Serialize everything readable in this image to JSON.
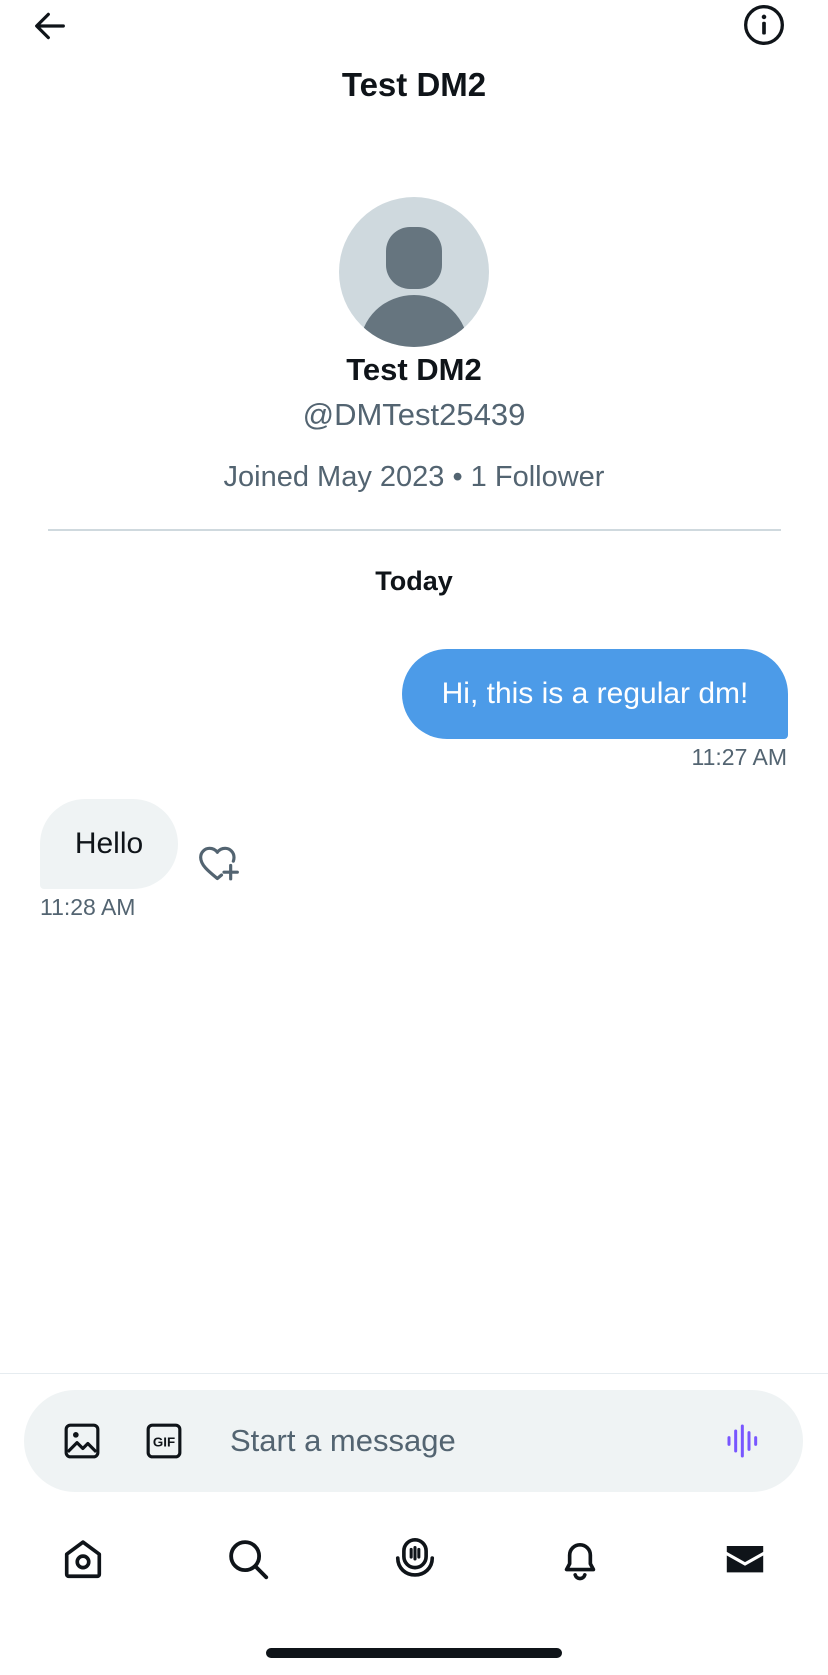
{
  "header": {
    "title": "Test DM2",
    "back_icon": "arrow-left-icon",
    "info_icon": "info-circle-icon"
  },
  "profile": {
    "name": "Test DM2",
    "handle": "@DMTest25439",
    "meta": "Joined May 2023 • 1 Follower",
    "avatar_icon": "default-avatar-icon"
  },
  "conversation": {
    "day_label": "Today",
    "messages": [
      {
        "direction": "outgoing",
        "text": "Hi, this is a regular dm!",
        "time": "11:27 AM"
      },
      {
        "direction": "incoming",
        "text": "Hello",
        "time": "11:28 AM"
      }
    ],
    "reaction_icon": "heart-plus-icon"
  },
  "composer": {
    "placeholder": "Start a message",
    "image_icon": "image-icon",
    "gif_icon": "gif-icon",
    "voice_icon": "voice-waveform-icon"
  },
  "tabbar": {
    "items": [
      {
        "name": "home",
        "icon": "home-icon"
      },
      {
        "name": "search",
        "icon": "search-icon"
      },
      {
        "name": "spaces",
        "icon": "spaces-microphone-icon"
      },
      {
        "name": "notifications",
        "icon": "bell-icon"
      },
      {
        "name": "messages",
        "icon": "mail-icon",
        "active": true
      }
    ]
  },
  "colors": {
    "accent": "#4c9be8",
    "text_primary": "#0f1419",
    "text_secondary": "#536471",
    "bubble_incoming": "#eff3f4",
    "voice_purple": "#7856ff"
  }
}
